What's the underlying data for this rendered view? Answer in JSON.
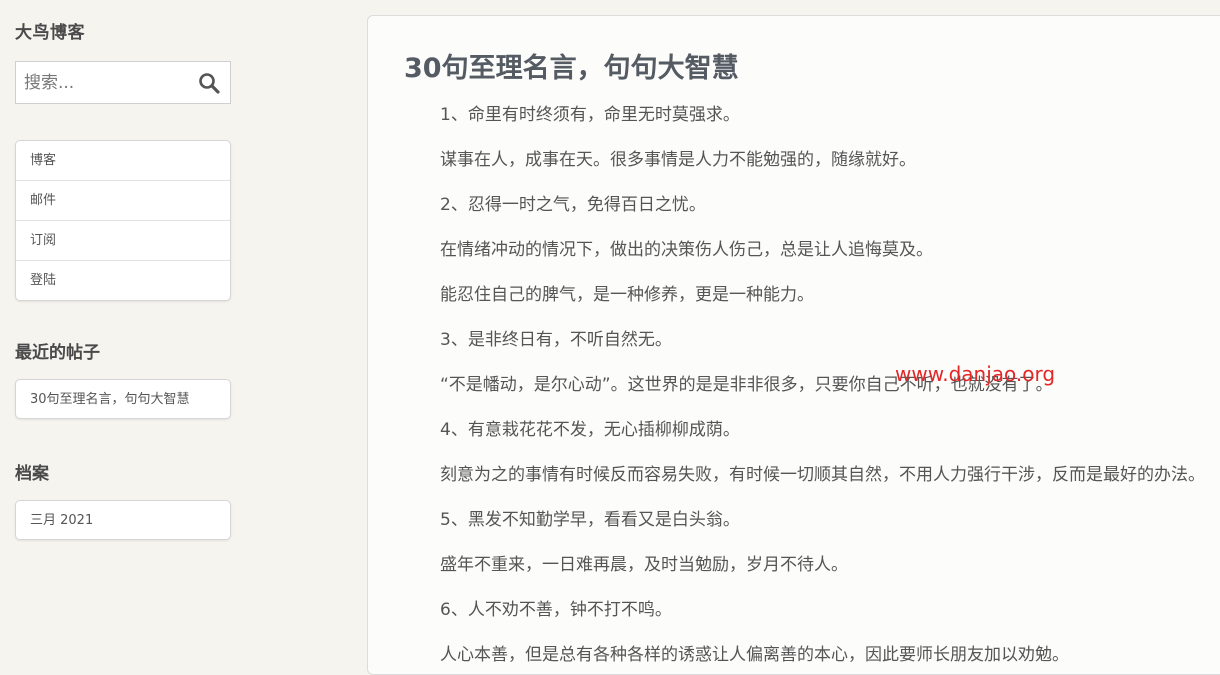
{
  "site": {
    "title": "大鸟博客"
  },
  "search": {
    "placeholder": "搜索..."
  },
  "nav": {
    "items": [
      {
        "label": "博客"
      },
      {
        "label": "邮件"
      },
      {
        "label": "订阅"
      },
      {
        "label": "登陆"
      }
    ]
  },
  "recent_posts": {
    "heading": "最近的帖子",
    "items": [
      {
        "label": "30句至理名言，句句大智慧"
      }
    ]
  },
  "archive": {
    "heading": "档案",
    "items": [
      {
        "label": "三月 2021"
      }
    ]
  },
  "post": {
    "title": "30句至理名言，句句大智慧",
    "paragraphs": [
      "1、命里有时终须有，命里无时莫强求。",
      "谋事在人，成事在天。很多事情是人力不能勉强的，随缘就好。",
      "2、忍得一时之气，免得百日之忧。",
      "在情绪冲动的情况下，做出的决策伤人伤己，总是让人追悔莫及。",
      "能忍住自己的脾气，是一种修养，更是一种能力。",
      "3、是非终日有，不听自然无。",
      "“不是幡动，是尔心动”。这世界的是是非非很多，只要你自己不听，也就没有了。",
      "4、有意栽花花不发，无心插柳柳成荫。",
      "刻意为之的事情有时候反而容易失败，有时候一切顺其自然，不用人力强行干涉，反而是最好的办法。",
      "5、黑发不知勤学早，看看又是白头翁。",
      "盛年不重来，一日难再晨，及时当勉励，岁月不待人。",
      "6、人不劝不善，钟不打不鸣。",
      "人心本善，但是总有各种各样的诱惑让人偏离善的本心，因此要师长朋友加以劝勉。"
    ]
  },
  "watermark": {
    "text": "www.danjao.org"
  },
  "colors": {
    "background": "#f6f4ef",
    "watermark": "#e32626"
  }
}
